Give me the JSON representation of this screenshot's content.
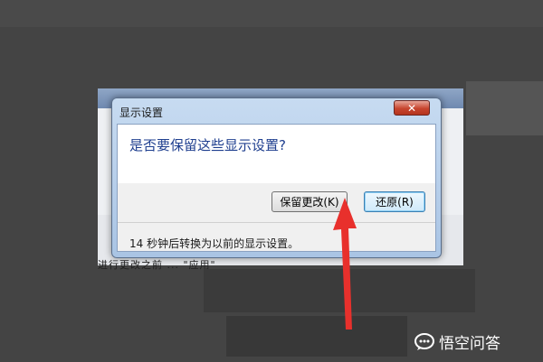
{
  "dialog": {
    "title": "显示设置",
    "close_label": "✕",
    "question": "是否要保留这些显示设置?",
    "keep_button": "保留更改(K)",
    "revert_button": "还原(R)",
    "countdown_text": "14 秒钟后转换为以前的显示设置。"
  },
  "background": {
    "partial_text": "进行更改之前 ... \"应用\""
  },
  "watermark": {
    "text": "悟空问答"
  },
  "colors": {
    "arrow": "#e8302c",
    "question_text": "#1f3f8f",
    "dialog_frame": "#b7cfea"
  }
}
